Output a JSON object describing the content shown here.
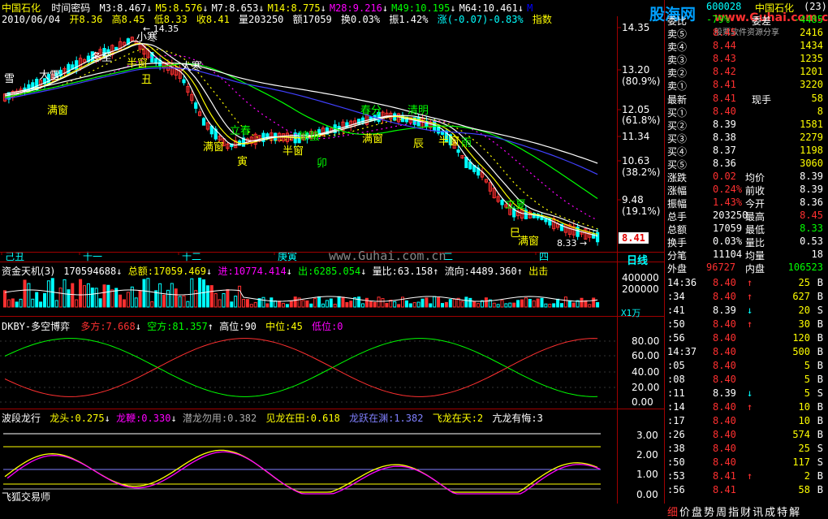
{
  "header": {
    "stock_name": "中国石化",
    "indicator": "时间密码",
    "ma_values": [
      {
        "label": "M3:8.467",
        "arrow": "↓",
        "color": "#ffffff"
      },
      {
        "label": "M5:8.576",
        "arrow": "↓",
        "color": "#ffff00"
      },
      {
        "label": "M7:8.653",
        "arrow": "↓",
        "color": "#ffffff"
      },
      {
        "label": "M14:8.775",
        "arrow": "↓",
        "color": "#ffff00"
      },
      {
        "label": "M28:9.216",
        "arrow": "↓",
        "color": "#ff00ff"
      },
      {
        "label": "M49:10.195",
        "arrow": "↓",
        "color": "#00ff00"
      },
      {
        "label": "M64:10.461",
        "arrow": "↓",
        "color": "#ffffff"
      },
      {
        "label": "M",
        "arrow": "",
        "color": "#0000ff"
      }
    ],
    "date": "2010/06/04",
    "open": "开8.36",
    "high": "高8.45",
    "low": "低8.33",
    "close": "收8.41",
    "volume": "量203250",
    "amount": "额17059",
    "turnover": "换0.03%",
    "amplitude": "振1.42%",
    "change": "涨(-0.07)-0.83%",
    "index_label": "指数"
  },
  "main_chart": {
    "y_ticks": [
      "14.35",
      "13.20",
      "(80.9%)",
      "12.05",
      "(61.8%)",
      "11.34",
      "10.63",
      "(38.2%)",
      "9.48",
      "(19.1%)"
    ],
    "current_price": "8.41",
    "high_label": "14.35",
    "low_label": "8.33",
    "annotations": [
      {
        "text": "雪",
        "color": "#ffffff"
      },
      {
        "text": "大雪",
        "color": "#ffffff"
      },
      {
        "text": "冬至",
        "color": "#ffffff"
      },
      {
        "text": "小寒",
        "color": "#ffffff"
      },
      {
        "text": "大寒",
        "color": "#ffffff"
      },
      {
        "text": "半窗",
        "color": "#ffff00"
      },
      {
        "text": "丑",
        "color": "#ffff00"
      },
      {
        "text": "满窗",
        "color": "#ffff00"
      },
      {
        "text": "立春",
        "color": "#00ff00"
      },
      {
        "text": "满窗",
        "color": "#ffff00"
      },
      {
        "text": "寅",
        "color": "#ffff00"
      },
      {
        "text": "惊蛰",
        "color": "#00ff00"
      },
      {
        "text": "半窗",
        "color": "#ffff00"
      },
      {
        "text": "卯",
        "color": "#00ff00"
      },
      {
        "text": "春分",
        "color": "#00ff00"
      },
      {
        "text": "满窗",
        "color": "#ffff00"
      },
      {
        "text": "清明",
        "color": "#00ff00"
      },
      {
        "text": "辰",
        "color": "#ffff00"
      },
      {
        "text": "半窗",
        "color": "#ffff00"
      },
      {
        "text": "雨",
        "color": "#00ff00"
      },
      {
        "text": "立夏",
        "color": "#00ff00"
      },
      {
        "text": "满窗",
        "color": "#ffff00"
      },
      {
        "text": "巳",
        "color": "#ffff00"
      }
    ],
    "x_labels": [
      "己丑",
      "十一",
      "十二",
      "庚寅",
      "二",
      "四"
    ],
    "period": "日线",
    "watermark": "www.Guhai.com.cn"
  },
  "capital_panel": {
    "title": "资金天机(3)",
    "v1": "170594688",
    "total_amount": "总额:17059.469",
    "inflow": "进:10774.414",
    "outflow": "出:6285.054",
    "ratio": "量比:63.158",
    "flow": "流向:4489.360",
    "tail": "出击",
    "y_ticks": [
      "400000",
      "200000"
    ],
    "unit": "X1万"
  },
  "dkby_panel": {
    "title": "DKBY-多空博弈",
    "bear": "多方:7.668",
    "bull": "空方:81.357",
    "high": "高位:90",
    "mid": "中位:45",
    "low": "低位:0",
    "y_ticks": [
      "80.00",
      "60.00",
      "40.00",
      "20.00",
      "0.00"
    ]
  },
  "wave_panel": {
    "title": "波段龙行",
    "head": "龙头:0.275",
    "tail": "龙鞭:0.330",
    "q1": "潜龙勿用:0.382",
    "q2": "见龙在田:0.618",
    "q3": "龙跃在渊:1.382",
    "q4": "飞龙在天:2",
    "q5": "亢龙有悔:3",
    "y_ticks": [
      "3.00",
      "2.00",
      "1.00",
      "0.00"
    ],
    "footer": "飞狐交易师"
  },
  "right_panel": {
    "code": "600028",
    "name": "中国石化",
    "page": "(23)",
    "weibi": "委比",
    "weibi_val": "-79%",
    "weicha": "委差",
    "weicha_val": "-4485",
    "sells": [
      {
        "label": "卖⑤",
        "price": "8.45",
        "vol": "2416"
      },
      {
        "label": "卖④",
        "price": "8.44",
        "vol": "1434"
      },
      {
        "label": "卖③",
        "price": "8.43",
        "vol": "1235"
      },
      {
        "label": "卖②",
        "price": "8.42",
        "vol": "1201"
      },
      {
        "label": "卖①",
        "price": "8.41",
        "vol": "3220"
      }
    ],
    "latest_label": "最新",
    "latest": "8.41",
    "now_hand_label": "现手",
    "now_hand": "58",
    "buys": [
      {
        "label": "买①",
        "price": "8.40",
        "vol": "8"
      },
      {
        "label": "买②",
        "price": "8.39",
        "vol": "1581"
      },
      {
        "label": "买③",
        "price": "8.38",
        "vol": "2279"
      },
      {
        "label": "买④",
        "price": "8.37",
        "vol": "1198"
      },
      {
        "label": "买⑤",
        "price": "8.36",
        "vol": "3060"
      }
    ],
    "stats": [
      {
        "l1": "涨跌",
        "v1": "0.02",
        "l2": "均价",
        "v2": "8.39"
      },
      {
        "l1": "涨幅",
        "v1": "0.24%",
        "l2": "前收",
        "v2": "8.39"
      },
      {
        "l1": "振幅",
        "v1": "1.43%",
        "l2": "今开",
        "v2": "8.36"
      },
      {
        "l1": "总手",
        "v1": "203250",
        "l2": "最高",
        "v2": "8.45"
      },
      {
        "l1": "总额",
        "v1": "17059",
        "l2": "最低",
        "v2": "8.33"
      },
      {
        "l1": "换手",
        "v1": "0.03%",
        "l2": "量比",
        "v2": "0.53"
      },
      {
        "l1": "分笔",
        "v1": "11104",
        "l2": "均量",
        "v2": "18"
      }
    ],
    "outer_label": "外盘",
    "outer": "96727",
    "inner_label": "内盘",
    "inner": "106523",
    "ticks": [
      {
        "time": "14:36",
        "price": "8.40",
        "arrow": "↑",
        "vol": "25",
        "side": "B"
      },
      {
        "time": ":34",
        "price": "8.40",
        "arrow": "↑",
        "vol": "627",
        "side": "B"
      },
      {
        "time": ":41",
        "price": "8.39",
        "arrow": "↓",
        "vol": "20",
        "side": "S"
      },
      {
        "time": ":50",
        "price": "8.40",
        "arrow": "↑",
        "vol": "30",
        "side": "B"
      },
      {
        "time": ":56",
        "price": "8.40",
        "arrow": "",
        "vol": "120",
        "side": "B"
      },
      {
        "time": "14:37",
        "price": "8.40",
        "arrow": "",
        "vol": "500",
        "side": "B"
      },
      {
        "time": ":05",
        "price": "8.40",
        "arrow": "",
        "vol": "5",
        "side": "B"
      },
      {
        "time": ":08",
        "price": "8.40",
        "arrow": "",
        "vol": "5",
        "side": "B"
      },
      {
        "time": ":11",
        "price": "8.39",
        "arrow": "↓",
        "vol": "5",
        "side": "S"
      },
      {
        "time": ":14",
        "price": "8.40",
        "arrow": "↑",
        "vol": "10",
        "side": "B"
      },
      {
        "time": ":17",
        "price": "8.40",
        "arrow": "",
        "vol": "10",
        "side": "B"
      },
      {
        "time": ":26",
        "price": "8.40",
        "arrow": "",
        "vol": "574",
        "side": "B"
      },
      {
        "time": ":38",
        "price": "8.40",
        "arrow": "",
        "vol": "25",
        "side": "S"
      },
      {
        "time": ":50",
        "price": "8.40",
        "arrow": "",
        "vol": "117",
        "side": "S"
      },
      {
        "time": ":53",
        "price": "8.41",
        "arrow": "↑",
        "vol": "2",
        "side": "B"
      },
      {
        "time": ":56",
        "price": "8.41",
        "arrow": "",
        "vol": "58",
        "side": "B"
      }
    ],
    "tabs": [
      "细",
      "价",
      "盘",
      "势",
      "周",
      "指",
      "财",
      "讯",
      "成",
      "特",
      "解"
    ],
    "logo": "股海网",
    "logo_url": "www.Guhai.com.cn",
    "logo_sub": "股票软件资源分享"
  }
}
